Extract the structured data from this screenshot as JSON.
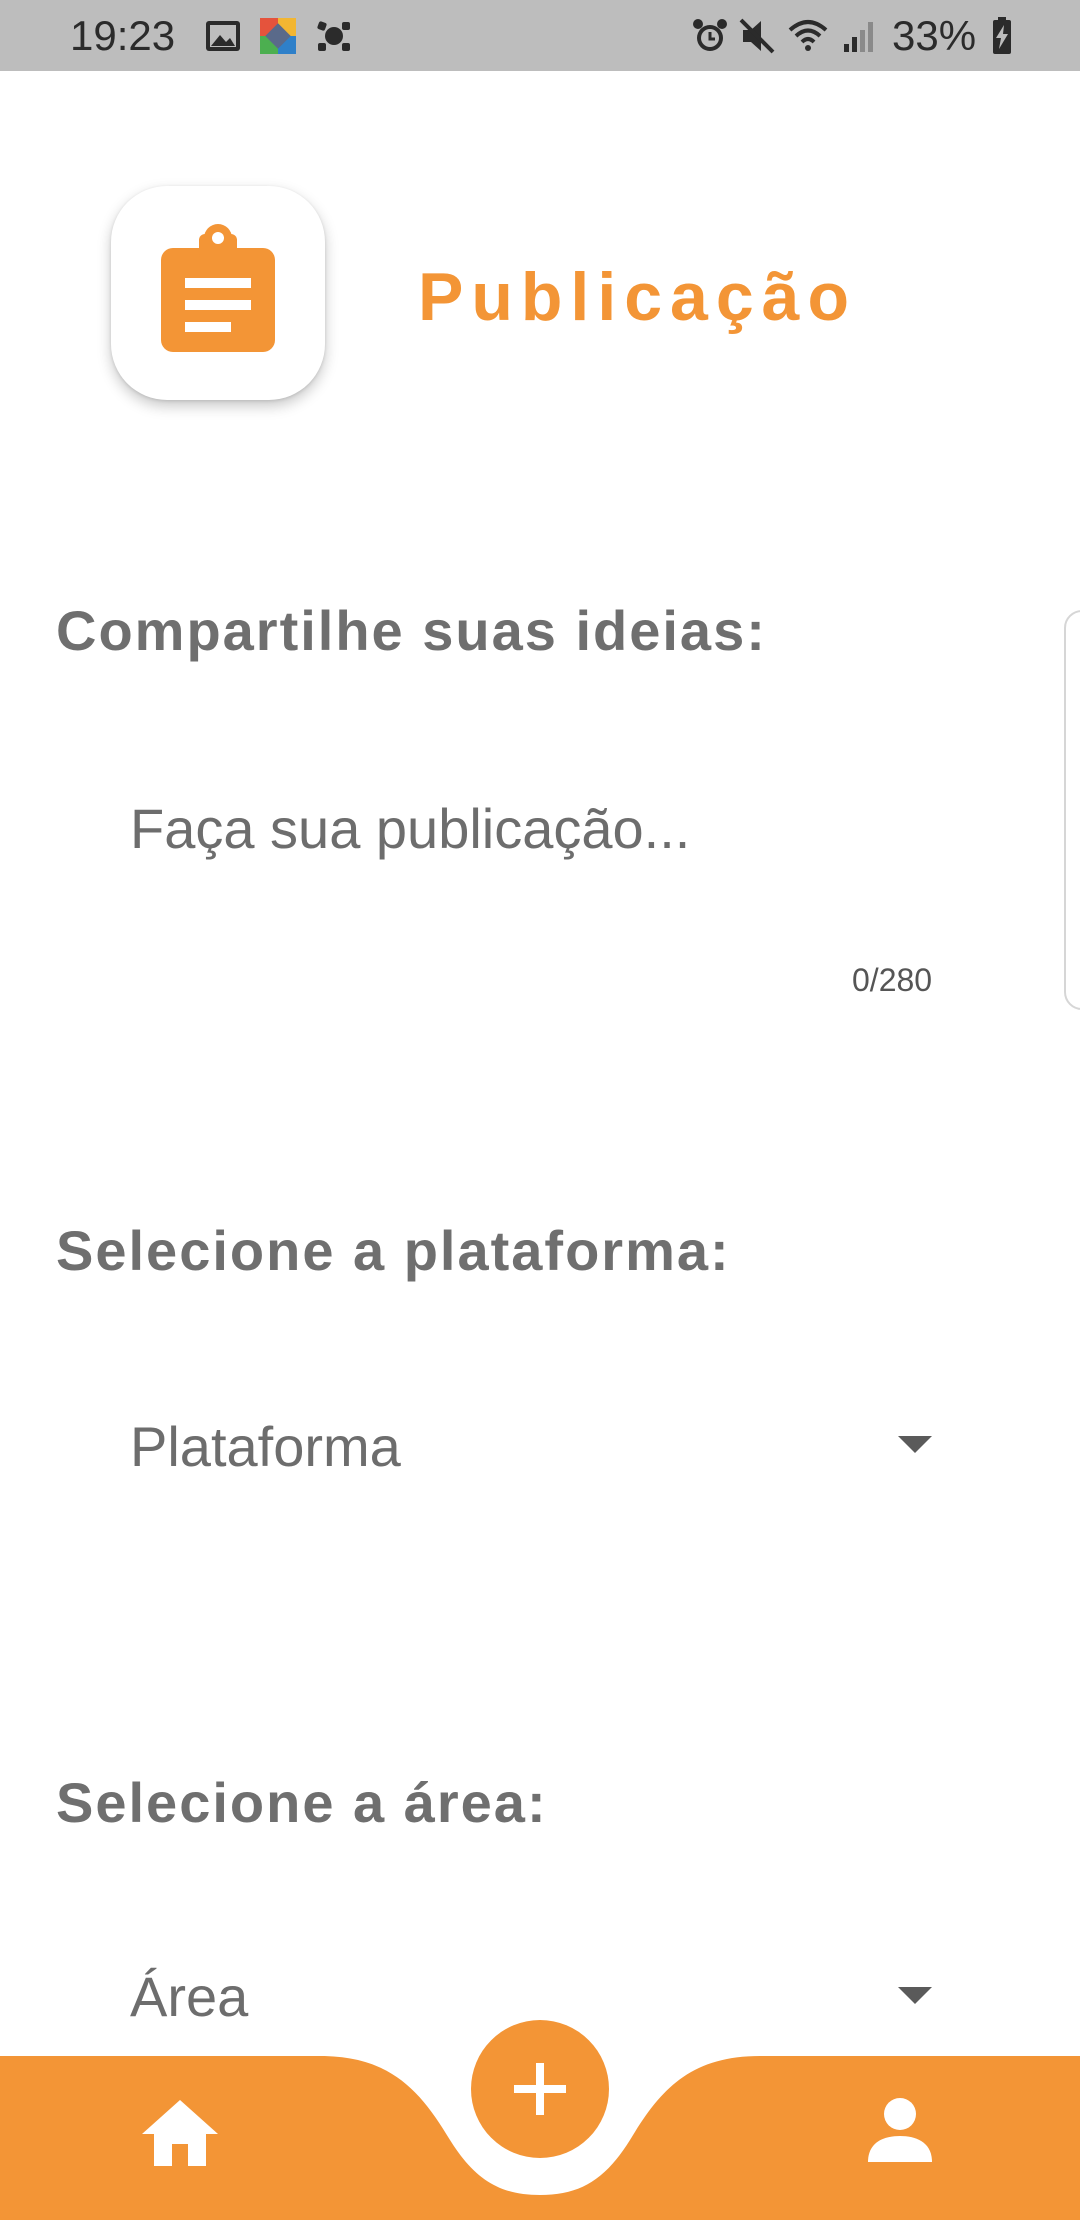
{
  "status_bar": {
    "time": "19:23",
    "battery": "33%",
    "icons": [
      "image-icon",
      "app-icon",
      "game-icon",
      "alarm-icon",
      "mute-icon",
      "wifi-icon",
      "signal-icon",
      "battery-icon"
    ]
  },
  "header": {
    "title": "Publicação",
    "icon": "clipboard-icon"
  },
  "form": {
    "ideas_label": "Compartilhe suas ideias:",
    "post_placeholder": "Faça sua publicação...",
    "char_counter": "0/280",
    "platform_label": "Selecione a plataforma:",
    "platform_value": "Plataforma",
    "area_label": "Selecione a área:",
    "area_value": "Área"
  },
  "bottom_nav": {
    "items": [
      "home-icon",
      "add-icon",
      "person-icon"
    ]
  },
  "colors": {
    "accent": "#f39536",
    "label": "#6f6f6f",
    "status_bar": "#bdbdbd"
  }
}
